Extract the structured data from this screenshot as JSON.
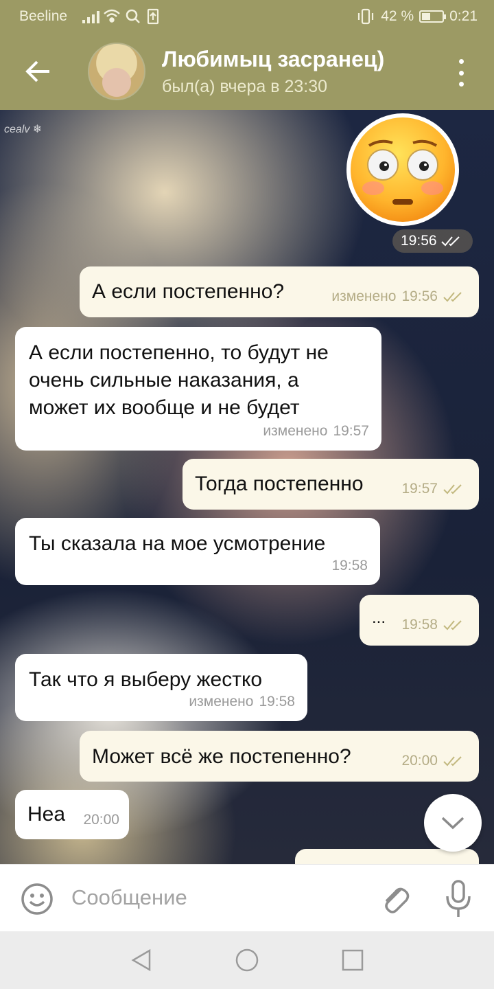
{
  "status_bar": {
    "carrier": "Beeline",
    "battery_text": "42 %",
    "battery_level": 0.42,
    "time": "0:21",
    "icons": [
      "signal-icon",
      "wifi-icon",
      "search-icon",
      "upload-icon",
      "vibrate-icon",
      "battery-icon"
    ]
  },
  "header": {
    "title": "Любимыц засранец)",
    "subtitle": "был(а) вчера в 23:30"
  },
  "watermark": "cealv ❄",
  "messages": [
    {
      "type": "sticker",
      "direction": "out",
      "sticker": "flushed-face-emoji",
      "time": "19:56",
      "read": true
    },
    {
      "direction": "out",
      "text": [
        "А если постепенно?"
      ],
      "edited_label": "изменено",
      "time": "19:56",
      "read": true
    },
    {
      "direction": "in",
      "text": [
        "А если постепенно, то будут не",
        "очень сильные наказания, а",
        "может их вообще и не будет"
      ],
      "edited_label": "изменено",
      "time": "19:57"
    },
    {
      "direction": "out",
      "text": [
        "Тогда постепенно"
      ],
      "time": "19:57",
      "read": true
    },
    {
      "direction": "in",
      "text": [
        "Ты сказала на мое усмотрение"
      ],
      "time": "19:58"
    },
    {
      "direction": "out",
      "text": [
        "..."
      ],
      "time": "19:58",
      "read": true
    },
    {
      "direction": "in",
      "text": [
        "Так что я выберу жестко"
      ],
      "edited_label": "изменено",
      "time": "19:58"
    },
    {
      "direction": "out",
      "text": [
        "Может всё же постепенно?"
      ],
      "time": "20:00",
      "read": true
    },
    {
      "direction": "in",
      "text": [
        "Неа"
      ],
      "time": "20:00"
    }
  ],
  "input": {
    "placeholder": "Сообщение"
  },
  "colors": {
    "header": "#9c9a64",
    "incoming_bubble": "#ffffff",
    "outgoing_bubble": "#fbf7e8",
    "read_ticks": "#c2b87e"
  }
}
